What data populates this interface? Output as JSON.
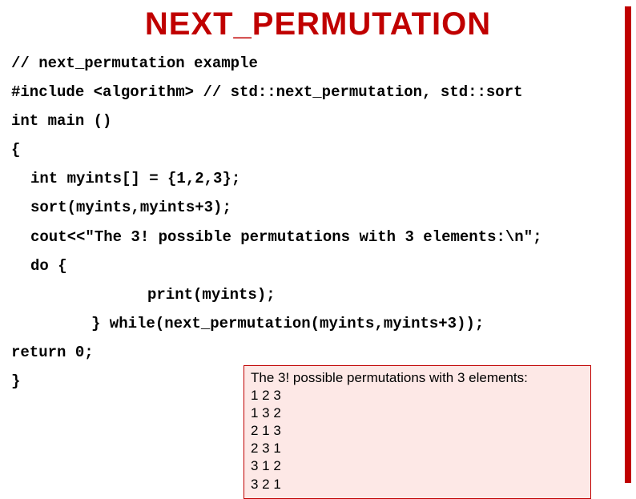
{
  "title": "NEXT_PERMUTATION",
  "code": {
    "l1": "// next_permutation example",
    "l2": "#include <algorithm> // std::next_permutation, std::sort",
    "l3": "int main ()",
    "l4": "{",
    "l5": "int myints[] = {1,2,3};",
    "l6": "sort(myints,myints+3);",
    "l7": "cout<<\"The 3! possible permutations with 3 elements:\\n\";",
    "l8": "do {",
    "l9": "print(myints);",
    "l10": "} while(next_permutation(myints,myints+3));",
    "l11": "return 0;",
    "l12": "}"
  },
  "output": {
    "o1": "The 3! possible permutations with 3 elements:",
    "o2": "1 2 3",
    "o3": "1 3 2",
    "o4": "2 1 3",
    "o5": "2 3 1",
    "o6": "3 1 2",
    "o7": "3 2 1"
  }
}
